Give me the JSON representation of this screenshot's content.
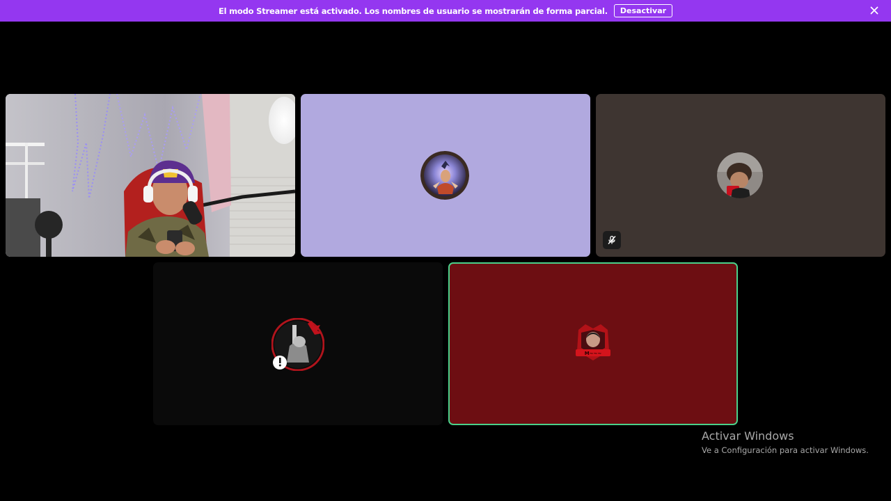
{
  "banner": {
    "message": "El modo Streamer está activado. Los nombres de usuario se mostrarán de forma parcial.",
    "button_label": "Desactivar",
    "close_icon": "close-icon",
    "color": "#9437f0"
  },
  "participants": [
    {
      "kind": "video",
      "background": "#b9b8bd"
    },
    {
      "kind": "avatar",
      "background": "#b1a9df"
    },
    {
      "kind": "avatar",
      "background": "#3e3531",
      "status_icon": "microphone-muted-icon"
    },
    {
      "kind": "avatar",
      "background": "#0a0a0a",
      "status_icon": "warning-icon"
    },
    {
      "kind": "avatar",
      "background": "#6d0e12",
      "speaking": true,
      "highlight_color": "#4bd18a"
    }
  ],
  "watermark": {
    "title": "Activar Windows",
    "subtitle": "Ve a Configuración para activar Windows."
  }
}
